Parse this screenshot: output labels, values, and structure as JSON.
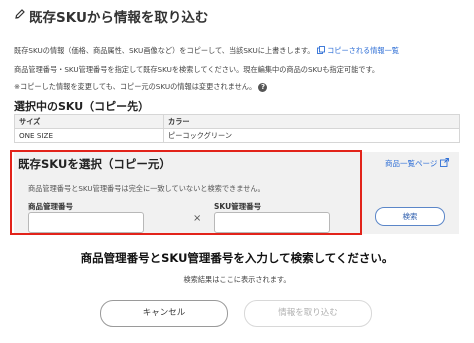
{
  "dialog": {
    "title": "既存SKUから情報を取り込む",
    "desc_line1": "既存SKUの情報（価格、商品属性、SKU画像など）をコピーして、当該SKUに上書きします。",
    "desc_link": "コピーされる情報一覧",
    "desc_line2": "商品管理番号・SKU管理番号を指定して既存SKUを検索してください。現在編集中の商品のSKUも指定可能です。",
    "desc_line3": "※コピーした情報を変更しても、コピー元のSKUの情報は変更されません。"
  },
  "selected": {
    "title": "選択中のSKU（コピー先）",
    "headers": [
      "サイズ",
      "カラー"
    ],
    "row": [
      "ONE SIZE",
      "ピーコックグリーン"
    ]
  },
  "source": {
    "title": "既存SKUを選択（コピー元）",
    "product_list_link": "商品一覧ページ",
    "note": "商品管理番号とSKU管理番号は完全に一致していないと検索できません。",
    "product_label": "商品管理番号",
    "product_value": "",
    "times": "×",
    "sku_label": "SKU管理番号",
    "sku_value": "",
    "search_label": "検索"
  },
  "result": {
    "message": "商品管理番号とSKU管理番号を入力して検索してください。",
    "placeholder": "検索結果はここに表示されます。"
  },
  "footer": {
    "cancel_label": "キャンセル",
    "import_label": "情報を取り込む"
  },
  "colors": {
    "accent_link": "#2f6fd6",
    "highlight_border": "#e2231a",
    "panel_bg": "#f1f1f1"
  },
  "icons": [
    "pencil-icon",
    "copy-icon",
    "help-icon",
    "external-link-icon"
  ]
}
